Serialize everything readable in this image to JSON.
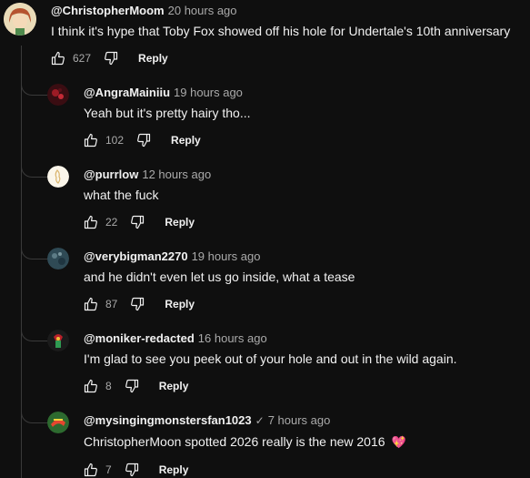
{
  "top_comment": {
    "author": "@ChristopherMoom",
    "time": "20 hours ago",
    "text": "I think it's hype that Toby Fox showed off his hole for Undertale's 10th anniversary",
    "likes": "627",
    "reply_label": "Reply"
  },
  "replies": [
    {
      "author": "@AngraMainiiu",
      "time": "19 hours ago",
      "text": "Yeah but it's pretty hairy tho...",
      "likes": "102",
      "reply_label": "Reply"
    },
    {
      "author": "@purrlow",
      "time": "12 hours ago",
      "text": "what the fuck",
      "likes": "22",
      "reply_label": "Reply"
    },
    {
      "author": "@verybigman2270",
      "time": "19 hours ago",
      "text": "and he didn't even let us go inside, what a tease",
      "likes": "87",
      "reply_label": "Reply"
    },
    {
      "author": "@moniker-redacted",
      "time": "16 hours ago",
      "text": "I'm glad to see you peek out of your hole and out in the wild again.",
      "likes": "8",
      "reply_label": "Reply"
    },
    {
      "author": "@mysingingmonstersfan1023",
      "verified_mark": "✓",
      "time": "7 hours ago",
      "text": "ChristopherMoon spotted 2026 really is the new 2016",
      "emoji": "💖",
      "likes": "7",
      "reply_label": "Reply"
    }
  ]
}
